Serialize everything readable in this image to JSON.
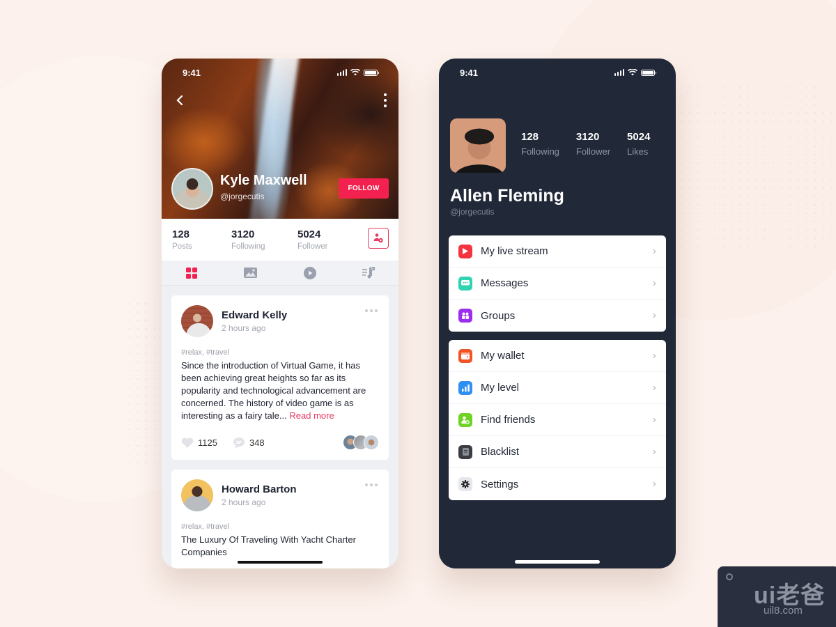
{
  "left_phone": {
    "status_time": "9:41",
    "profile": {
      "name": "Kyle Maxwell",
      "handle": "@jorgecutis",
      "follow_label": "FOLLOW"
    },
    "stats": [
      {
        "value": "128",
        "label": "Posts"
      },
      {
        "value": "3120",
        "label": "Following"
      },
      {
        "value": "5024",
        "label": "Follower"
      }
    ],
    "tabs": [
      {
        "name": "grid",
        "icon": "grid-icon",
        "active": true
      },
      {
        "name": "photos",
        "icon": "image-icon",
        "active": false
      },
      {
        "name": "videos",
        "icon": "play-icon",
        "active": false
      },
      {
        "name": "music",
        "icon": "music-icon",
        "active": false
      }
    ],
    "posts": [
      {
        "author": "Edward Kelly",
        "time": "2 hours ago",
        "tags": "#relax, #travel",
        "body": "Since the introduction of Virtual Game, it has been achieving great heights so far as its popularity and technological advancement are concerned. The history of video game is as interesting as a fairy tale...",
        "read_more": "Read more",
        "likes": "1125",
        "comments": "348"
      },
      {
        "author": "Howard Barton",
        "time": "2 hours ago",
        "tags": "#relax, #travel",
        "body": "The Luxury Of Traveling With Yacht Charter Companies"
      }
    ]
  },
  "right_phone": {
    "status_time": "9:41",
    "profile": {
      "name": "Allen Fleming",
      "handle": "@jorgecutis"
    },
    "stats": [
      {
        "value": "128",
        "label": "Following"
      },
      {
        "value": "3120",
        "label": "Follower"
      },
      {
        "value": "5024",
        "label": "Likes"
      }
    ],
    "menu_group_1": [
      {
        "label": "My live stream",
        "icon": "play-icon",
        "color": "#f5333f"
      },
      {
        "label": "Messages",
        "icon": "chat-icon",
        "color": "#2ed3b2"
      },
      {
        "label": "Groups",
        "icon": "group-icon",
        "color": "#9b2ef0"
      }
    ],
    "menu_group_2": [
      {
        "label": "My wallet",
        "icon": "wallet-icon",
        "color": "#f45425"
      },
      {
        "label": "My level",
        "icon": "bar-chart-icon",
        "color": "#2f8ff2"
      },
      {
        "label": "Find friends",
        "icon": "find-user-icon",
        "color": "#6ed324"
      },
      {
        "label": "Blacklist",
        "icon": "blacklist-icon",
        "color": "#3a3d42"
      },
      {
        "label": "Settings",
        "icon": "gear-icon",
        "color": "#e6e7ec"
      }
    ]
  },
  "watermark": {
    "logo": "ui老爸",
    "url": "uil8.com"
  },
  "colors": {
    "accent": "#f3214f",
    "dark_bg": "#212838",
    "page_bg": "#fcf1ec"
  }
}
